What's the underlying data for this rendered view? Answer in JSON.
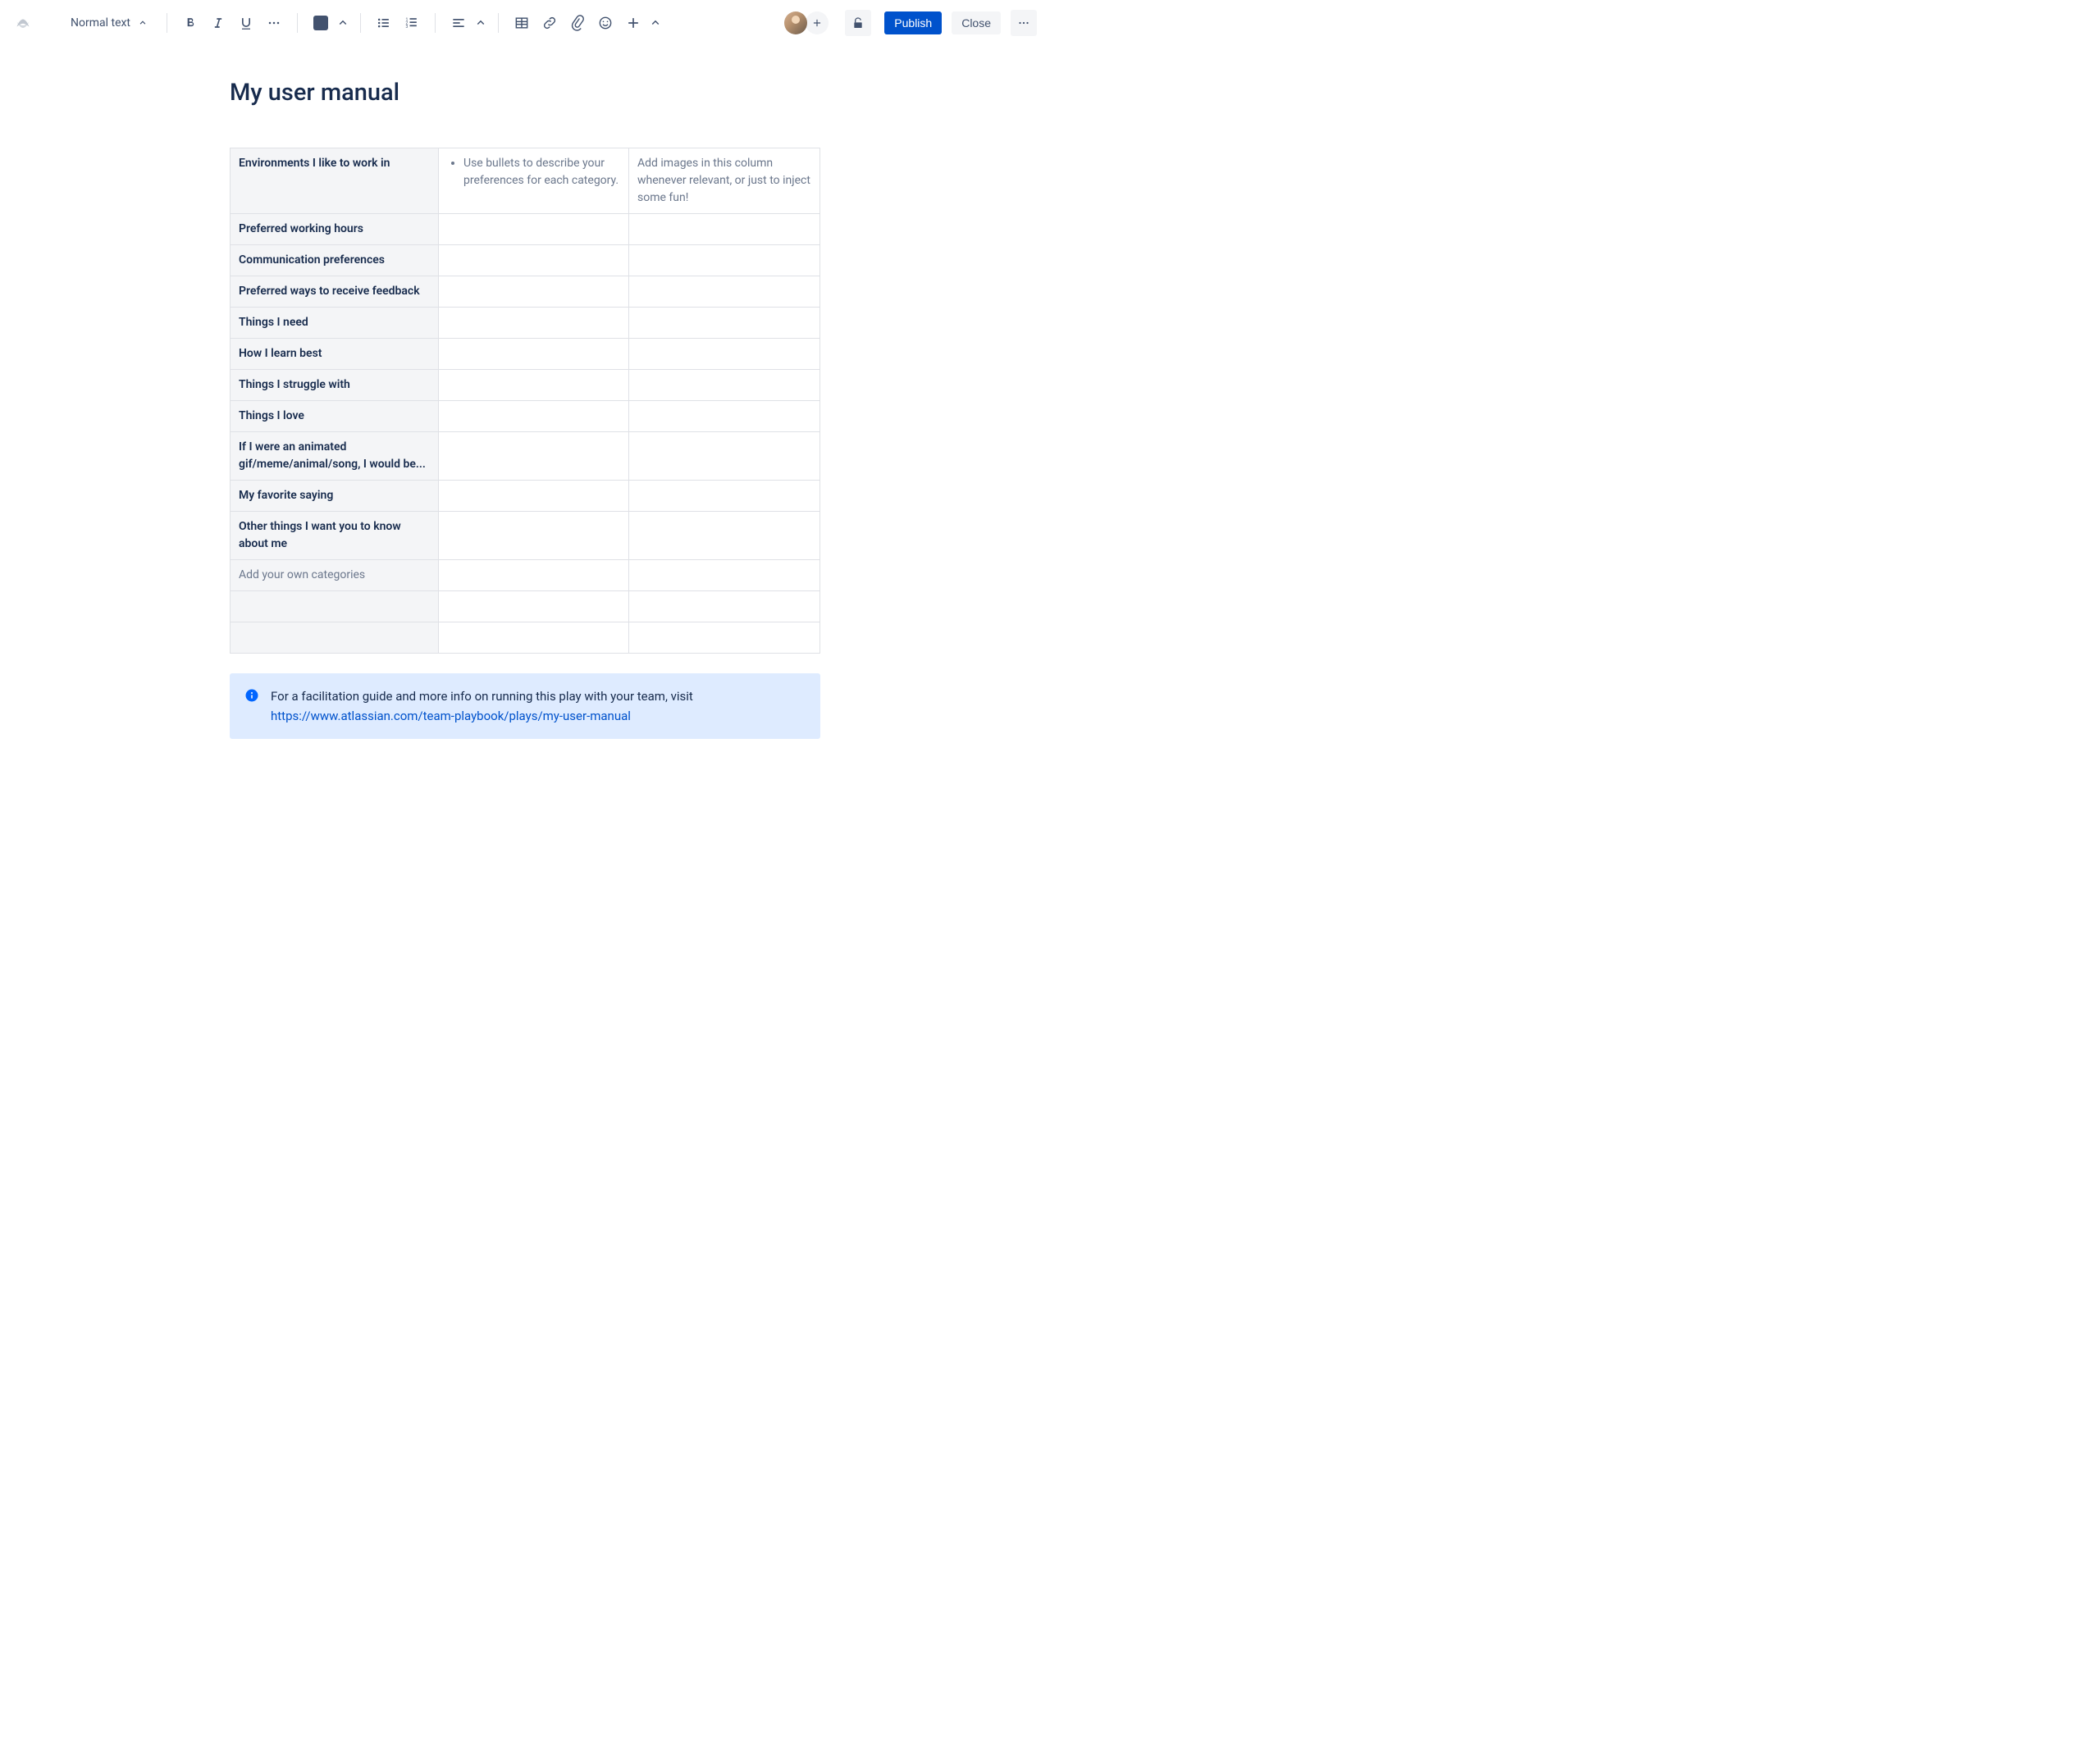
{
  "toolbar": {
    "textStyle": "Normal text",
    "publish": "Publish",
    "close": "Close"
  },
  "page": {
    "title": "My user manual"
  },
  "table": {
    "rows": [
      {
        "cat": "Environments I like to work in",
        "col2_bullet": "Use bullets to describe your preferences for each category.",
        "col3": "Add images in this column whenever relevant, or just to inject some fun!",
        "placeholder": false
      },
      {
        "cat": "Preferred working hours",
        "col2_bullet": "",
        "col3": "",
        "placeholder": false
      },
      {
        "cat": "Communication preferences",
        "col2_bullet": "",
        "col3": "",
        "placeholder": false
      },
      {
        "cat": "Preferred ways to receive feedback",
        "col2_bullet": "",
        "col3": "",
        "placeholder": false
      },
      {
        "cat": "Things I need",
        "col2_bullet": "",
        "col3": "",
        "placeholder": false
      },
      {
        "cat": "How I learn best",
        "col2_bullet": "",
        "col3": "",
        "placeholder": false
      },
      {
        "cat": "Things I struggle with",
        "col2_bullet": "",
        "col3": "",
        "placeholder": false
      },
      {
        "cat": "Things I love",
        "col2_bullet": "",
        "col3": "",
        "placeholder": false
      },
      {
        "cat": "If I were an animated gif/meme/animal/song, I would be...",
        "col2_bullet": "",
        "col3": "",
        "placeholder": false
      },
      {
        "cat": "My favorite saying",
        "col2_bullet": "",
        "col3": "",
        "placeholder": false
      },
      {
        "cat": "Other things I want you to know about me",
        "col2_bullet": "",
        "col3": "",
        "placeholder": false
      },
      {
        "cat": "Add your own categories",
        "col2_bullet": "",
        "col3": "",
        "placeholder": true
      },
      {
        "cat": "",
        "col2_bullet": "",
        "col3": "",
        "placeholder": false
      },
      {
        "cat": "",
        "col2_bullet": "",
        "col3": "",
        "placeholder": false
      }
    ]
  },
  "info": {
    "text": "For a facilitation guide and more info on running this play with your team, visit",
    "link": "https://www.atlassian.com/team-playbook/plays/my-user-manual"
  }
}
